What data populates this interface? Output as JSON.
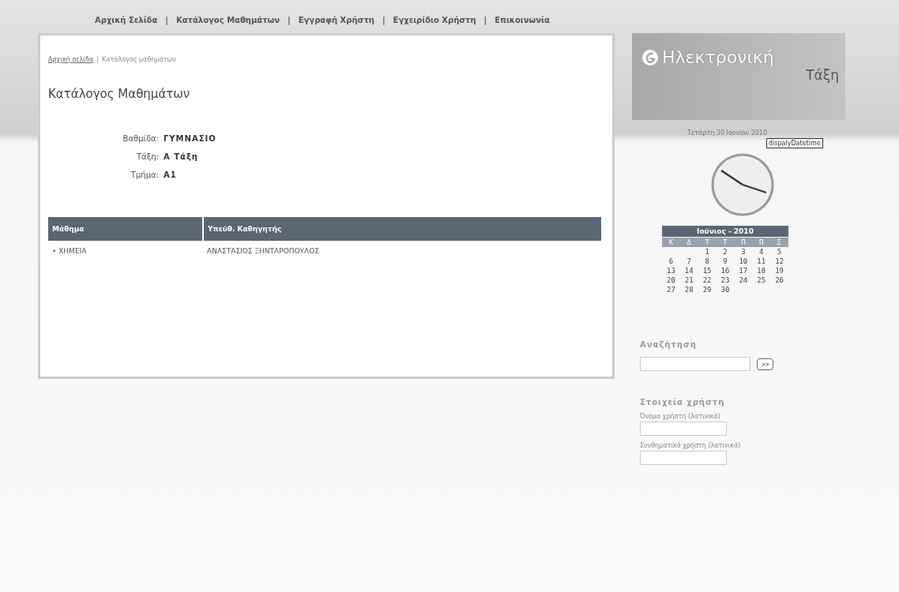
{
  "nav": [
    "Αρχική Σελίδα",
    "Κατάλογος Μαθημάτων",
    "Εγγραφή Χρήστη",
    "Εγχειρίδιο Χρήστη",
    "Επικοινωνία"
  ],
  "nav_separator": "|",
  "breadcrumb": {
    "link": "Αρχική σελίδα",
    "separator": "|",
    "current": "Κατάλογος μαθημάτων"
  },
  "page_title": "Κατάλογος Μαθημάτων",
  "details": [
    {
      "label": "Βαθμίδα:",
      "value": "ΓΥΜΝΑΣΙΟ"
    },
    {
      "label": "Τάξη:",
      "value": "Α Τάξη"
    },
    {
      "label": "Τμήμα:",
      "value": "Α1"
    }
  ],
  "table": {
    "columns": [
      "Μάθημα",
      "Υπεύθ. Καθηγητής"
    ],
    "rows": [
      {
        "bullet": "•",
        "course": "ΧΗΜΕΙΑ",
        "teacher": "ΑΝΑΣΤΑΣΙΟΣ ΞΗΝΤΑΡΟΠΟΥΛΟΣ"
      }
    ]
  },
  "logo": {
    "line1": "Ηλεκτρονική",
    "line2": "Τάξη"
  },
  "date": "Τετάρτη 30 Ιουνίου 2010",
  "tooltip": "dispalyDatetime",
  "calendar": {
    "title": "Ιούνιος - 2010",
    "weekdays": [
      "Κ",
      "Δ",
      "Τ",
      "Τ",
      "Π",
      "Π",
      "Σ"
    ],
    "weeks": [
      [
        "1",
        "2",
        "3",
        "4",
        "5"
      ],
      [
        "6",
        "7",
        "8",
        "9",
        "10",
        "11",
        "12"
      ],
      [
        "13",
        "14",
        "15",
        "16",
        "17",
        "18",
        "19"
      ],
      [
        "20",
        "21",
        "22",
        "23",
        "24",
        "25",
        "26"
      ],
      [
        "27",
        "28",
        "29",
        "30"
      ]
    ]
  },
  "search": {
    "title": "Αναζήτηση",
    "button": ">>"
  },
  "user": {
    "title": "Στοιχεία χρήστη",
    "fields": [
      "Όνομα χρήστη (λατινικά)",
      "Συνθηματικό χρήστη (λατινικά)"
    ]
  }
}
